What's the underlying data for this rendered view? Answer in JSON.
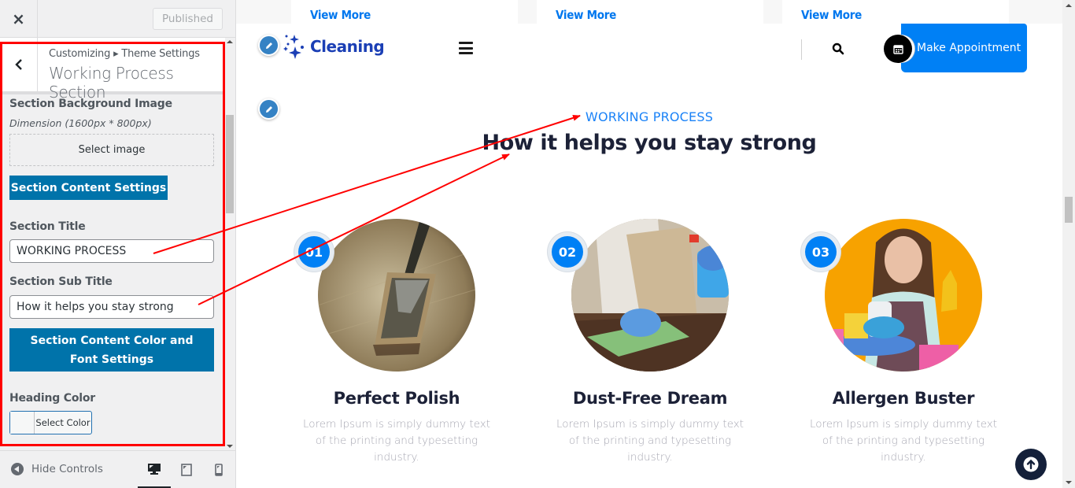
{
  "customizer": {
    "close_label": "×",
    "publish_status": "Published",
    "breadcrumb": "Customizing ▸ Theme Settings",
    "section_title": "Working Process Section",
    "controls": {
      "bg_image_label": "Section Background Image",
      "bg_image_desc": "Dimension (1600px * 800px)",
      "select_image_label": "Select image",
      "content_settings_label": "Section Content Settings",
      "title_label": "Section Title",
      "title_value": "WORKING PROCESS",
      "subtitle_label": "Section Sub Title",
      "subtitle_value": "How it helps you stay strong",
      "color_font_label": "Section Content Color and Font Settings",
      "heading_color_label": "Heading Color",
      "select_color_label": "Select Color"
    },
    "footer": {
      "hide_controls_label": "Hide Controls",
      "devices": [
        "desktop",
        "tablet",
        "mobile"
      ],
      "active_device": "desktop"
    }
  },
  "preview": {
    "services_strip": {
      "cards": [
        {
          "link_label": "View More"
        },
        {
          "link_label": "View More"
        },
        {
          "link_label": "View More"
        }
      ]
    },
    "header": {
      "logo_text": "Cleaning",
      "appointment_label": "Make Appointment"
    },
    "working_process": {
      "kicker": "WORKING PROCESS",
      "heading": "How it helps you stay strong",
      "steps": [
        {
          "number": "01",
          "title": "Perfect Polish",
          "description": "Lorem Ipsum is simply dummy text of the printing and typesetting industry.",
          "image": "mop-on-floor"
        },
        {
          "number": "02",
          "title": "Dust-Free Dream",
          "description": "Lorem Ipsum is simply dummy text of the printing and typesetting industry.",
          "image": "wiping-table-with-spray"
        },
        {
          "number": "03",
          "title": "Allergen Buster",
          "description": "Lorem Ipsum is simply dummy text of the printing and typesetting industry.",
          "image": "woman-with-cleaning-supplies"
        }
      ]
    }
  },
  "colors": {
    "accent_blue": "#0080f5",
    "kicker_blue": "#1a82f7",
    "heading_dark": "#1c2137",
    "wp_button_blue": "#0073aa",
    "annotation_red": "#ff0000",
    "logo_blue": "#1b3fb5"
  }
}
